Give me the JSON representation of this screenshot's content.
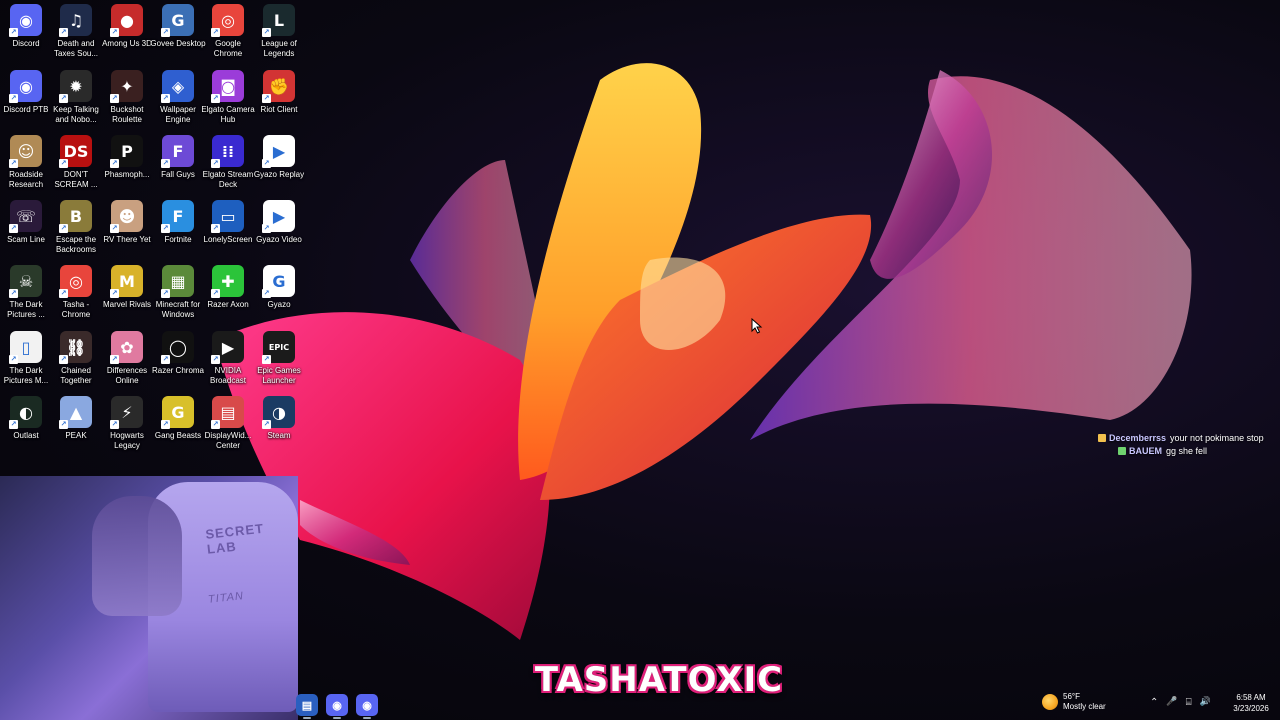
{
  "desktop": {
    "icons": [
      {
        "label": "Discord",
        "icon": "discord-icon",
        "color": "#5865F2",
        "glyph": "◉"
      },
      {
        "label": "Death and Taxes Sou...",
        "icon": "music-note-icon",
        "color": "#1f2b4a",
        "glyph": "♫"
      },
      {
        "label": "Among Us 3D",
        "icon": "among-us-icon",
        "color": "#c62b2b",
        "glyph": "●"
      },
      {
        "label": "Govee Desktop",
        "icon": "govee-icon",
        "color": "#3b6fb5",
        "glyph": "G"
      },
      {
        "label": "Google Chrome",
        "icon": "chrome-icon",
        "color": "#e8453c",
        "glyph": "◎"
      },
      {
        "label": "League of Legends",
        "icon": "league-icon",
        "color": "#1a2a2e",
        "glyph": "L"
      },
      {
        "label": "Discord PTB",
        "icon": "discord-ptb-icon",
        "color": "#5865F2",
        "glyph": "◉"
      },
      {
        "label": "Keep Talking and Nobo...",
        "icon": "bomb-icon",
        "color": "#2a2a2a",
        "glyph": "✹"
      },
      {
        "label": "Buckshot Roulette",
        "icon": "buckshot-icon",
        "color": "#3a2020",
        "glyph": "✦"
      },
      {
        "label": "Wallpaper Engine",
        "icon": "wallpaper-engine-icon",
        "color": "#2f5fd0",
        "glyph": "◈"
      },
      {
        "label": "Elgato Camera Hub",
        "icon": "camera-icon",
        "color": "#9b3cd9",
        "glyph": "◙"
      },
      {
        "label": "Riot Client",
        "icon": "riot-icon",
        "color": "#d23434",
        "glyph": "✊"
      },
      {
        "label": "Roadside Research",
        "icon": "roadside-icon",
        "color": "#b08a55",
        "glyph": "☺"
      },
      {
        "label": "DON'T SCREAM ...",
        "icon": "dont-scream-icon",
        "color": "#b81010",
        "glyph": "DS"
      },
      {
        "label": "Phasmoph...",
        "icon": "phasmophobia-icon",
        "color": "#111111",
        "glyph": "P"
      },
      {
        "label": "Fall Guys",
        "icon": "fall-guys-icon",
        "color": "#6d4ad6",
        "glyph": "F"
      },
      {
        "label": "Elgato Stream Deck",
        "icon": "stream-deck-icon",
        "color": "#3a2ad0",
        "glyph": "⁞⁞"
      },
      {
        "label": "Gyazo Replay",
        "icon": "gyazo-replay-icon",
        "color": "#ffffff",
        "glyph": "▶"
      },
      {
        "label": "Scam Line",
        "icon": "scam-line-icon",
        "color": "#2a1a3a",
        "glyph": "☏"
      },
      {
        "label": "Escape the Backrooms",
        "icon": "backrooms-icon",
        "color": "#8a7b3a",
        "glyph": "B"
      },
      {
        "label": "RV There Yet",
        "icon": "rv-icon",
        "color": "#c9a080",
        "glyph": "☻"
      },
      {
        "label": "Fortnite",
        "icon": "fortnite-icon",
        "color": "#2a8fe0",
        "glyph": "F"
      },
      {
        "label": "LonelyScreen",
        "icon": "monitor-icon",
        "color": "#1e5fbf",
        "glyph": "▭"
      },
      {
        "label": "Gyazo Video",
        "icon": "gyazo-video-icon",
        "color": "#ffffff",
        "glyph": "▶"
      },
      {
        "label": "The Dark Pictures ...",
        "icon": "dark-pictures-icon",
        "color": "#2a3a2a",
        "glyph": "☠"
      },
      {
        "label": "Tasha - Chrome",
        "icon": "chrome-profile-icon",
        "color": "#e8453c",
        "glyph": "◎"
      },
      {
        "label": "Marvel Rivals",
        "icon": "marvel-rivals-icon",
        "color": "#d8b22a",
        "glyph": "M"
      },
      {
        "label": "Minecraft for Windows",
        "icon": "minecraft-icon",
        "color": "#5b8a3a",
        "glyph": "▦"
      },
      {
        "label": "Razer Axon",
        "icon": "razer-axon-icon",
        "color": "#2bc43a",
        "glyph": "✚"
      },
      {
        "label": "Gyazo",
        "icon": "gyazo-icon",
        "color": "#ffffff",
        "glyph": "G"
      },
      {
        "label": "The Dark Pictures M...",
        "icon": "document-icon",
        "color": "#f2f2f2",
        "glyph": "▯"
      },
      {
        "label": "Chained Together",
        "icon": "chained-together-icon",
        "color": "#3a2a2a",
        "glyph": "⛓"
      },
      {
        "label": "Differences Online",
        "icon": "cake-icon",
        "color": "#e07aa0",
        "glyph": "✿"
      },
      {
        "label": "Razer Chroma",
        "icon": "razer-chroma-icon",
        "color": "#111111",
        "glyph": "◯"
      },
      {
        "label": "NVIDIA Broadcast",
        "icon": "nvidia-icon",
        "color": "#1a1a1a",
        "glyph": "▶"
      },
      {
        "label": "Epic Games Launcher",
        "icon": "epic-games-icon",
        "color": "#1b1b1b",
        "glyph": "EPIC"
      },
      {
        "label": "Outlast",
        "icon": "outlast-icon",
        "color": "#1a2a22",
        "glyph": "◐"
      },
      {
        "label": "PEAK",
        "icon": "peak-icon",
        "color": "#8aa8e0",
        "glyph": "▲"
      },
      {
        "label": "Hogwarts Legacy",
        "icon": "hogwarts-icon",
        "color": "#2a2a2a",
        "glyph": "⚡"
      },
      {
        "label": "Gang Beasts",
        "icon": "gang-beasts-icon",
        "color": "#d8c02a",
        "glyph": "G"
      },
      {
        "label": "DisplayWid... Center",
        "icon": "displaywidget-icon",
        "color": "#d84a4a",
        "glyph": "▤"
      },
      {
        "label": "Steam",
        "icon": "steam-icon",
        "color": "#1b3b63",
        "glyph": "◑"
      }
    ]
  },
  "webcam": {
    "brand": "SECRET LAB",
    "model": "TITAN"
  },
  "chat": {
    "messages": [
      {
        "user": "Decemberrss",
        "text": "your not pokimane stop"
      },
      {
        "user": "BAUEM",
        "text": "gg she fell"
      }
    ]
  },
  "overlay": {
    "stream_name": "TASHATOXIC"
  },
  "taskbar": {
    "apps": [
      {
        "name": "notepad-icon",
        "color": "#2a5fc0",
        "glyph": "▤"
      },
      {
        "name": "discord-taskbar-icon",
        "color": "#5865F2",
        "glyph": "◉"
      },
      {
        "name": "discord-ptb-taskbar-icon",
        "color": "#5865F2",
        "glyph": "◉"
      }
    ],
    "weather": {
      "temp": "56°F",
      "condition": "Mostly clear"
    },
    "tray": {
      "chevron": "⌃",
      "mic": "🎤",
      "network": "⌸",
      "volume": "🔊"
    },
    "clock": {
      "time": "6:58 AM",
      "date": "3/23/2026"
    }
  }
}
